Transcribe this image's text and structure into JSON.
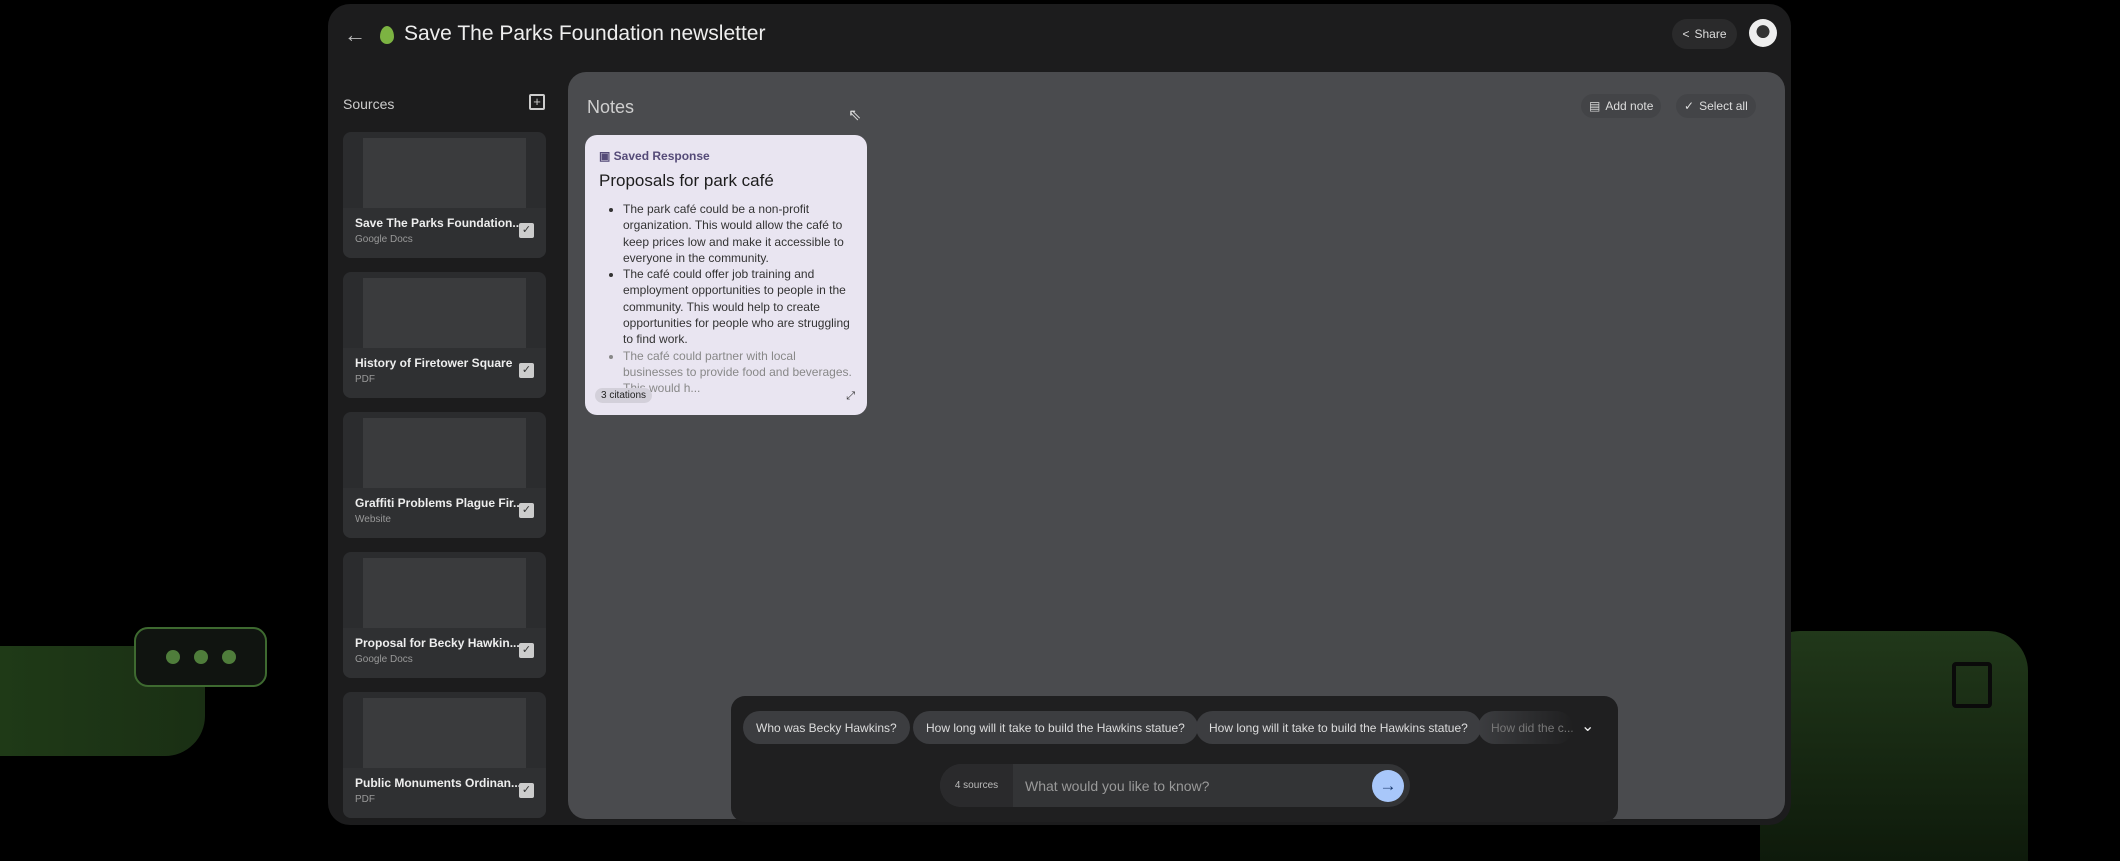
{
  "header": {
    "title": "Save The Parks Foundation newsletter",
    "share_label": "Share"
  },
  "sources": {
    "label": "Sources",
    "items": [
      {
        "name": "Save The Parks Foundation...",
        "type": "Google Docs",
        "checked": true
      },
      {
        "name": "History of Firetower Square",
        "type": "PDF",
        "checked": true
      },
      {
        "name": "Graffiti Problems Plague Fir...",
        "type": "Website",
        "checked": true
      },
      {
        "name": "Proposal for Becky Hawkin...",
        "type": "Google Docs",
        "checked": true
      },
      {
        "name": "Public Monuments Ordinan...",
        "type": "PDF",
        "checked": true
      }
    ]
  },
  "notes": {
    "title": "Notes",
    "add_note": "Add note",
    "select_all": "Select all",
    "card": {
      "kind": "Saved Response",
      "title": "Proposals for park café",
      "bullets": [
        "The park café could be a non-profit organization. This would allow the café to keep prices low and make it accessible to everyone in the community.",
        "The café could offer job training and employment opportunities to people in the community. This would help to create opportunities for people who are struggling to find work.",
        "The café could partner with local businesses to provide food and beverages. This would h..."
      ],
      "citations": "3 citations"
    }
  },
  "chat": {
    "suggestions": [
      "Who was Becky Hawkins?",
      "How long will it take to build the Hawkins statue?",
      "How long will it take to build the Hawkins statue?",
      "How did the c..."
    ],
    "source_count": "4 sources",
    "placeholder": "What would you like to know?"
  },
  "colors": {
    "accent": "#a8c7fa",
    "note_bg": "#e9e5f1",
    "green": "#4f7d3b"
  }
}
